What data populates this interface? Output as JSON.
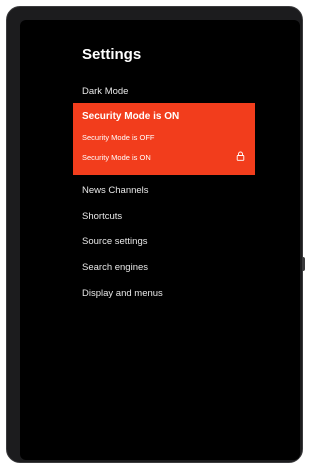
{
  "settings": {
    "title": "Settings",
    "menu": [
      "Dark Mode",
      "News Channels",
      "Shortcuts",
      "Source settings",
      "Search engines",
      "Display and menus"
    ]
  },
  "security_dropdown": {
    "selected_label": "Security Mode is ON",
    "options": [
      "Security Mode is OFF",
      "Security Mode is ON"
    ],
    "background_color": "#f23d1c",
    "selected_option_icon": "lock-icon"
  }
}
